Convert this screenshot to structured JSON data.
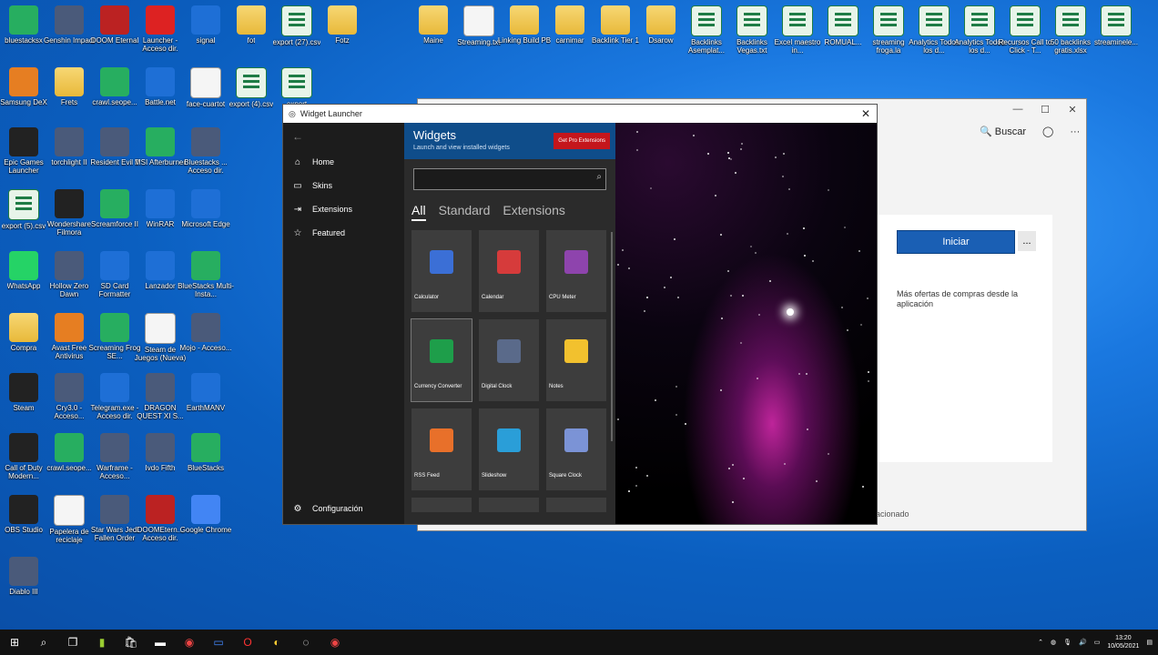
{
  "desktop_icons": [
    {
      "label": "bluestacksx",
      "kind": "green"
    },
    {
      "label": "Genshin Impact",
      "kind": "game"
    },
    {
      "label": "DOOM Eternal",
      "kind": "red"
    },
    {
      "label": "Launcher - Acceso dir.",
      "kind": "opera"
    },
    {
      "label": "signal",
      "kind": "blue"
    },
    {
      "label": "fot",
      "kind": "folder"
    },
    {
      "label": "export (27).csv",
      "kind": "sheet"
    },
    {
      "label": "Fotz",
      "kind": "folder"
    },
    {
      "label": "Maine",
      "kind": "folder"
    },
    {
      "label": "Streaming.txt",
      "kind": "doc"
    },
    {
      "label": "Linking Build PB",
      "kind": "folder"
    },
    {
      "label": "carnimar",
      "kind": "folder"
    },
    {
      "label": "Backlink Tier 1",
      "kind": "folder"
    },
    {
      "label": "Dsarow",
      "kind": "folder"
    },
    {
      "label": "Backlinks Asemplat...",
      "kind": "sheet"
    },
    {
      "label": "Backlinks Vegas.txt",
      "kind": "sheet"
    },
    {
      "label": "Excel maestro in...",
      "kind": "sheet"
    },
    {
      "label": "ROMUAL...",
      "kind": "sheet"
    },
    {
      "label": "streaming froga.la",
      "kind": "sheet"
    },
    {
      "label": "Analytics Todos los d...",
      "kind": "sheet"
    },
    {
      "label": "Analytics Todos los d...",
      "kind": "sheet"
    },
    {
      "label": "Recursos Call to Click - T...",
      "kind": "sheet"
    },
    {
      "label": "50 backlinks gratis.xlsx",
      "kind": "sheet"
    },
    {
      "label": "streaminele...",
      "kind": "sheet"
    },
    {
      "label": "Samsung DeX",
      "kind": "orange"
    },
    {
      "label": "Frets",
      "kind": "folder"
    },
    {
      "label": "crawl.seope...",
      "kind": "green"
    },
    {
      "label": "Battle.net",
      "kind": "blue"
    },
    {
      "label": "face-cuartot",
      "kind": "doc"
    },
    {
      "label": "export (4).csv",
      "kind": "sheet"
    },
    {
      "label": "export",
      "kind": "sheet"
    },
    {
      "label": "Epic Games Launcher",
      "kind": "dark"
    },
    {
      "label": "torchlight II",
      "kind": "game"
    },
    {
      "label": "Resident Evil 7",
      "kind": "game"
    },
    {
      "label": "MSI Afterburner",
      "kind": "green"
    },
    {
      "label": "Bluestacks ... Acceso dir.",
      "kind": "game"
    },
    {
      "label": "export (5).csv",
      "kind": "sheet"
    },
    {
      "label": "Wondershare Filmora",
      "kind": "dark"
    },
    {
      "label": "Screamforce II",
      "kind": "green"
    },
    {
      "label": "WinRAR",
      "kind": "blue"
    },
    {
      "label": "Microsoft Edge",
      "kind": "blue"
    },
    {
      "label": "WhatsApp",
      "kind": "wa"
    },
    {
      "label": "Hollow Zero Dawn",
      "kind": "game"
    },
    {
      "label": "SD Card Formatter",
      "kind": "blue"
    },
    {
      "label": "Lanzador",
      "kind": "blue"
    },
    {
      "label": "BlueStacks Multi-Insta...",
      "kind": "green"
    },
    {
      "label": "Compra",
      "kind": "folder"
    },
    {
      "label": "Avast Free Antivirus",
      "kind": "orange"
    },
    {
      "label": "Screaming Frog SE...",
      "kind": "green"
    },
    {
      "label": "Steam de Juegos (Nueva)",
      "kind": "doc"
    },
    {
      "label": "Mojo - Acceso...",
      "kind": "game"
    },
    {
      "label": "Steam",
      "kind": "dark"
    },
    {
      "label": "Cry3.0 - Acceso...",
      "kind": "game"
    },
    {
      "label": "Telegram.exe - Acceso dir.",
      "kind": "blue"
    },
    {
      "label": "DRAGON QUEST XI S...",
      "kind": "game"
    },
    {
      "label": "EarthMANV",
      "kind": "blue"
    },
    {
      "label": "Call of Duty Modern...",
      "kind": "dark"
    },
    {
      "label": "crawl.seope...",
      "kind": "green"
    },
    {
      "label": "Warframe - Acceso...",
      "kind": "game"
    },
    {
      "label": "Ivdo Fifth",
      "kind": "game"
    },
    {
      "label": "BlueStacks",
      "kind": "green"
    },
    {
      "label": "OBS Studio",
      "kind": "dark"
    },
    {
      "label": "Papelera de reciclaje",
      "kind": "doc"
    },
    {
      "label": "Star Wars Jedi Fallen Order",
      "kind": "game"
    },
    {
      "label": "DOOMEtern... Acceso dir.",
      "kind": "red"
    },
    {
      "label": "Google Chrome",
      "kind": "chrome"
    },
    {
      "label": "Diablo III",
      "kind": "game"
    }
  ],
  "bg_window": {
    "search_label": "Buscar",
    "start_button": "Iniciar",
    "more_label": "...",
    "offers_text": "Más ofertas de compras desde la aplicación",
    "related_text": "acionado"
  },
  "widget_launcher": {
    "title": "Widget Launcher",
    "nav": [
      {
        "label": "Home",
        "icon": "home-icon"
      },
      {
        "label": "Skins",
        "icon": "skins-icon"
      },
      {
        "label": "Extensions",
        "icon": "extensions-icon"
      },
      {
        "label": "Featured",
        "icon": "star-icon"
      }
    ],
    "settings_label": "Configuración",
    "banner_title": "Widgets",
    "banner_subtitle": "Launch and view installed widgets",
    "pro_button": "Get Pro Extensions",
    "search_placeholder": "",
    "tabs": [
      "All",
      "Standard",
      "Extensions"
    ],
    "tiles": [
      {
        "label": "Calculator",
        "color": "#3b6fd6"
      },
      {
        "label": "Calendar",
        "color": "#d63b3b"
      },
      {
        "label": "CPU Meter",
        "color": "#8e44ad"
      },
      {
        "label": "Currency Converter",
        "color": "#1e9e4a"
      },
      {
        "label": "Digital Clock",
        "color": "#5a6a8a"
      },
      {
        "label": "Notes",
        "color": "#f2c12e"
      },
      {
        "label": "RSS Feed",
        "color": "#e8702a"
      },
      {
        "label": "Slideshow",
        "color": "#2a9ed8"
      },
      {
        "label": "Square Clock",
        "color": "#7b93d6"
      }
    ]
  },
  "taskbar": {
    "time": "13:20",
    "date": "10/05/2021"
  }
}
